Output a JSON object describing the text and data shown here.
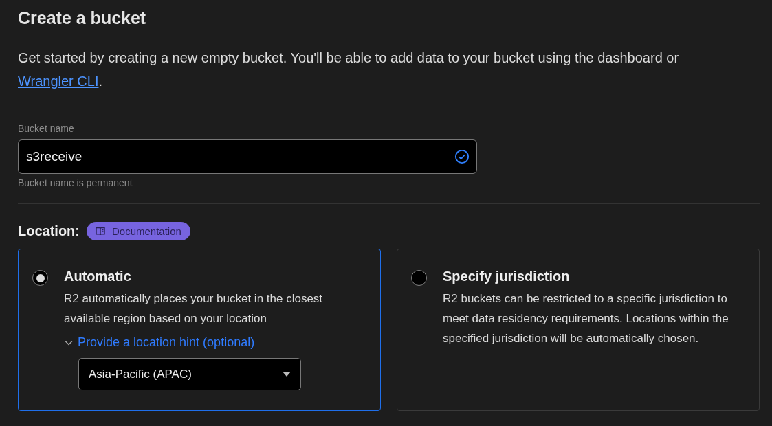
{
  "title": "Create a bucket",
  "intro": {
    "text": "Get started by creating a new empty bucket. You'll be able to add data to your bucket using the dashboard or ",
    "link": "Wrangler CLI",
    "after": "."
  },
  "bucket_name": {
    "label": "Bucket name",
    "value": "s3receive",
    "valid": true,
    "help": "Bucket name is permanent"
  },
  "location": {
    "label": "Location:",
    "docs_badge": "Documentation"
  },
  "options": [
    {
      "title": "Automatic",
      "description": "R2 automatically places your bucket in the closest available region based on your location",
      "selected": true,
      "hint": {
        "label": "Provide a location hint (optional)",
        "expanded": true,
        "value": "Asia-Pacific (APAC)"
      }
    },
    {
      "title": "Specify jurisdiction",
      "description": "R2 buckets can be restricted to a specific jurisdiction to meet data residency requirements. Locations within the specified jurisdiction will be automatically chosen.",
      "selected": false
    }
  ]
}
